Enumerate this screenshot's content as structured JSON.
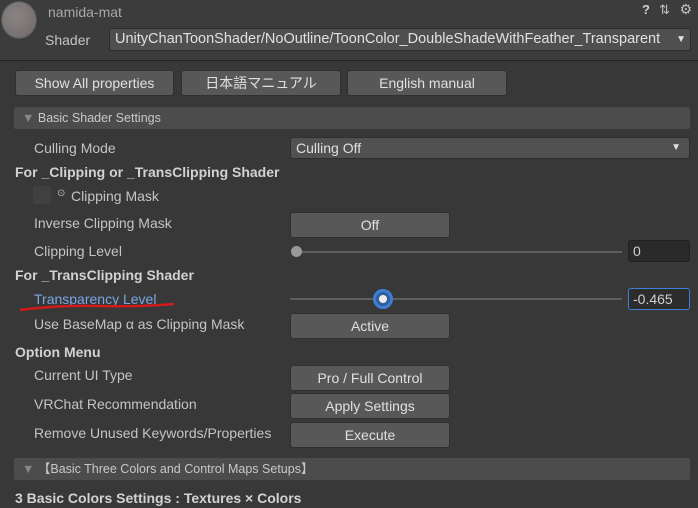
{
  "material": {
    "name": "namida-mat",
    "shader_label": "Shader",
    "shader_value": "UnityChanToonShader/NoOutline/ToonColor_DoubleShadeWithFeather_Transparent"
  },
  "toolbar": {
    "show_all": "Show All properties",
    "jp_manual": "日本語マニュアル",
    "en_manual": "English manual"
  },
  "sections": {
    "basic": "Basic Shader Settings",
    "three_colors": "【Basic Three Colors and Control Maps Setups】"
  },
  "culling": {
    "label": "Culling Mode",
    "value": "Culling Off"
  },
  "clipping_header": "For _Clipping or _TransClipping Shader",
  "clipping_mask": {
    "label": "Clipping Mask",
    "checked": false
  },
  "inverse": {
    "label": "Inverse Clipping Mask",
    "value": "Off"
  },
  "clip_level": {
    "label": "Clipping Level",
    "value": "0",
    "fraction": 0
  },
  "trans_header": "For _TransClipping Shader",
  "transparency": {
    "label": "Transparency Level",
    "value": "-0.465",
    "range": [
      -1,
      1
    ],
    "numeric": -0.465
  },
  "basemap_alpha": {
    "label": "Use BaseMap α as Clipping Mask",
    "value": "Active"
  },
  "option_header": "Option Menu",
  "ui_type": {
    "label": "Current UI Type",
    "value": "Pro / Full Control"
  },
  "vrchat": {
    "label": "VRChat Recommendation",
    "value": "Apply Settings"
  },
  "remove_unused": {
    "label": "Remove Unused Keywords/Properties",
    "value": "Execute"
  },
  "colors_header": "3 Basic Colors Settings : Textures × Colors",
  "colors": {
    "link": "#7ca6e6",
    "accent": "#3d7fd6",
    "underline": "#d11a1a"
  }
}
